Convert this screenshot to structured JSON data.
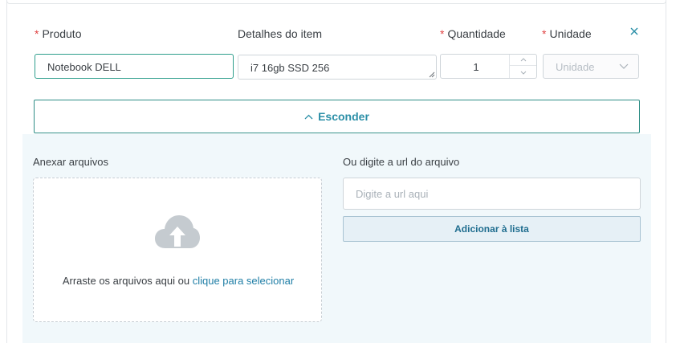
{
  "form": {
    "produto": {
      "label": "Produto",
      "required": true,
      "value": "Notebook DELL"
    },
    "detalhes": {
      "label": "Detalhes do item",
      "required": false,
      "value": "i7 16gb SSD 256"
    },
    "quantidade": {
      "label": "Quantidade",
      "required": true,
      "value": "1"
    },
    "unidade": {
      "label": "Unidade",
      "required": true,
      "placeholder": "Unidade"
    },
    "required_mark": "*"
  },
  "toggle": {
    "label": "Esconder",
    "icon": "chevron-up-icon"
  },
  "attachments": {
    "upload_label": "Anexar arquivos",
    "drop_text": "Arraste os arquivos aqui ou",
    "drop_link": "clique para selecionar",
    "upload_icon": "cloud-upload-icon",
    "url_label": "Ou digite a url do arquivo",
    "url_placeholder": "Digite a url aqui",
    "add_button": "Adicionar à lista"
  },
  "colors": {
    "accent": "#2b8fa7",
    "required": "#e04141",
    "panel_bg": "#f1f8fb",
    "focus_border": "#2e9e8c"
  }
}
